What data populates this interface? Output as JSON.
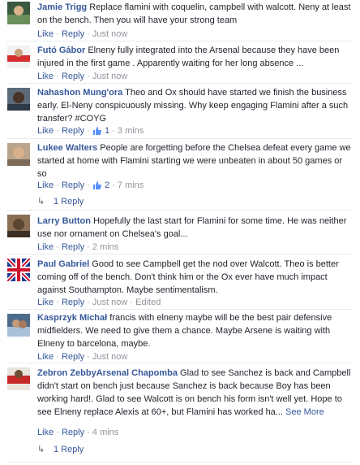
{
  "comments": [
    {
      "author": "Jamie Trigg",
      "text": "Replace flamini with coquelin, campbell with walcott. Neny at least on the bench. Then you will have your strong team",
      "like": "Like",
      "reply": "Reply",
      "time": "Just now"
    },
    {
      "author": "Futó Gábor",
      "text": "Elneny fully integrated into the Arsenal because they have been injured in the first game . Apparently waiting for her long absence ...",
      "like": "Like",
      "reply": "Reply",
      "time": "Just now"
    },
    {
      "author": "Nahashon Mung'ora",
      "text": "Theo and Ox should have started we finish the business early. El-Neny conspicuously missing. Why keep engaging Flamini after a such transfer? #COYG",
      "like": "Like",
      "reply": "Reply",
      "likes": "1",
      "time": "3 mins"
    },
    {
      "author": "Lukee Walters",
      "text": "People are forgetting before the Chelsea defeat every game we started at home with Flamini starting we were unbeaten in about 50 games or so",
      "like": "Like",
      "reply": "Reply",
      "likes": "2",
      "time": "7 mins",
      "replies": "1 Reply"
    },
    {
      "author": "Larry Button",
      "text": "Hopefully the last start for Flamini for some time. He was neither use nor ornament on Chelsea's goal...",
      "like": "Like",
      "reply": "Reply",
      "time": "2 mins"
    },
    {
      "author": "Paul Gabriel",
      "text": "Good to see Campbell get the nod over Walcott. Theo is better coming off of the bench. Don't think him or the Ox ever have much impact against Southampton. Maybe sentimentalism.",
      "like": "Like",
      "reply": "Reply",
      "time": "Just now",
      "edited": "Edited"
    },
    {
      "author": "Kasprzyk Michał",
      "text": "francis with elneny maybe will be the best pair defensive midfielders. We need to give them a chance. Maybe Arsene is waiting with Elneny to barcelona, maybe.",
      "like": "Like",
      "reply": "Reply",
      "time": "Just now"
    },
    {
      "author": "Zebron ZebbyArsenal Chapomba",
      "text": "Glad to see Sanchez is back and Campbell didn't start on bench just because Sanchez is back because Boy has been working hard!. Glad to see Walcott is on bench his form isn't well yet. Hope to see Elneny replace Alexis at 60+, but Flamini has worked ha...",
      "see_more": "See More",
      "like": "Like",
      "reply": "Reply",
      "time": "4 mins",
      "replies": "1 Reply"
    }
  ],
  "separator": "·",
  "colors": {
    "link": "#365899",
    "meta": "#90949c",
    "text": "#1d2129"
  }
}
